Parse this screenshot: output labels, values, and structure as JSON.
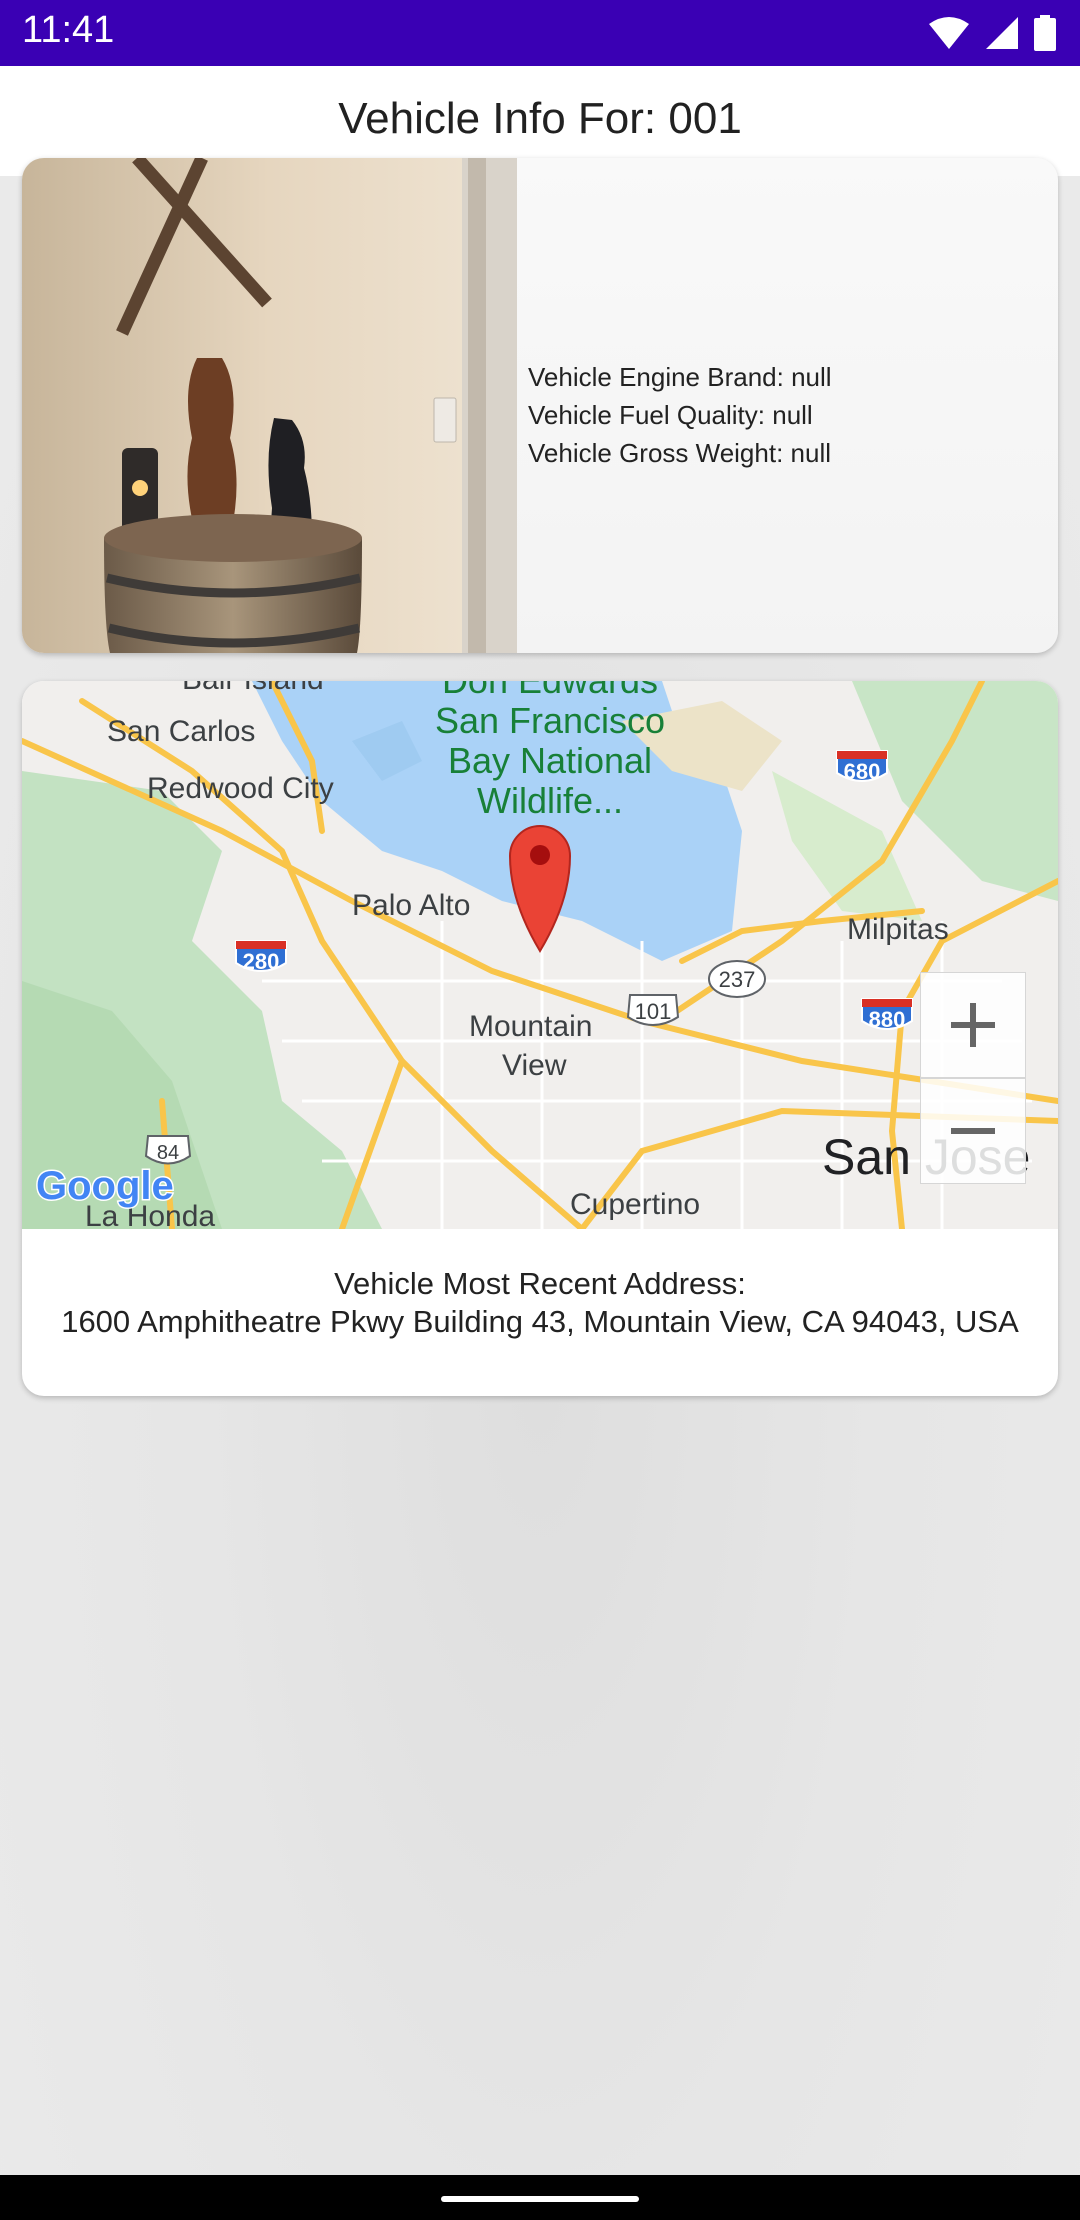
{
  "status_bar": {
    "time": "11:41",
    "icons": [
      "wifi-icon",
      "signal-icon",
      "battery-icon"
    ]
  },
  "page": {
    "title": "Vehicle Info For: 001"
  },
  "vehicle_card": {
    "photo": "vehicle-photo",
    "engine_brand": "Vehicle Engine Brand: null",
    "fuel_quality": "Vehicle Fuel Quality: null",
    "gross_weight": "Vehicle Gross Weight: null"
  },
  "map_card": {
    "places": {
      "bair_island": "Bair Island",
      "san_carlos": "San Carlos",
      "redwood_city": "Redwood City",
      "refuge_line1": "Don Edwards",
      "refuge_line2": "San Francisco",
      "refuge_line3": "Bay National",
      "refuge_line4": "Wildlife...",
      "palo_alto": "Palo Alto",
      "milpitas": "Milpitas",
      "mountain_view_line1": "Mountain",
      "mountain_view_line2": "View",
      "san_jose": "San Jose",
      "cupertino": "Cupertino",
      "la_honda": "La Honda"
    },
    "shields": {
      "i680": "680",
      "i280": "280",
      "r237": "237",
      "us101": "101",
      "i880": "880",
      "r84": "84"
    },
    "attribution": "Google",
    "zoom_in_label": "+",
    "zoom_out_label": "−",
    "address_label": "Vehicle Most Recent Address:",
    "address_value": "1600 Amphitheatre Pkwy Building 43, Mountain View, CA 94043, USA"
  },
  "colors": {
    "status_bar": "#3a00b4",
    "map_water": "#aad2f7",
    "map_park": "#c3e2c2",
    "map_highway": "#f9c54a",
    "marker": "#ea4335"
  }
}
